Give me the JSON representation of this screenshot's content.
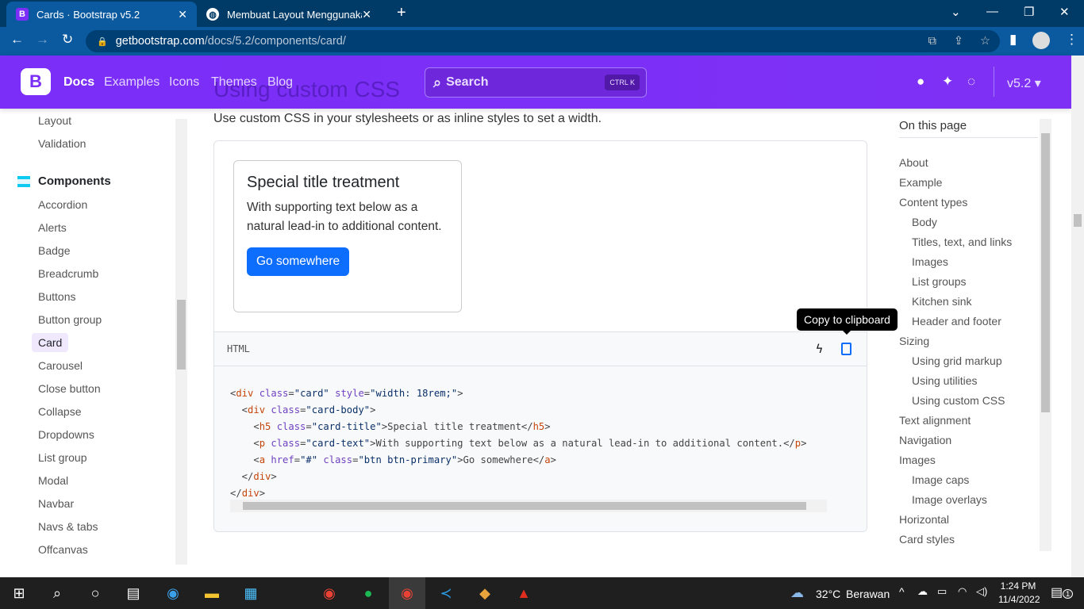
{
  "browser": {
    "tabs": [
      {
        "label": "Cards · Bootstrap v5.2",
        "favicon": "bootstrap-icon",
        "active": true
      },
      {
        "label": "Membuat Layout Menggunakan",
        "favicon": "globe-icon",
        "active": false
      }
    ],
    "url_host": "getbootstrap.com",
    "url_path": "/docs/5.2/components/card/"
  },
  "navbar": {
    "brand": "B",
    "links": [
      "Docs",
      "Examples",
      "Icons",
      "Themes",
      "Blog"
    ],
    "search_placeholder": "Search",
    "search_kbd": "CTRL K",
    "version": "v5.2",
    "accent": "#7a2ef7"
  },
  "sidebar": {
    "top_items": [
      "Layout",
      "Validation"
    ],
    "section": "Components",
    "items": [
      "Accordion",
      "Alerts",
      "Badge",
      "Breadcrumb",
      "Buttons",
      "Button group",
      "Card",
      "Carousel",
      "Close button",
      "Collapse",
      "Dropdowns",
      "List group",
      "Modal",
      "Navbar",
      "Navs & tabs",
      "Offcanvas"
    ],
    "active": "Card"
  },
  "main": {
    "heading": "Using custom CSS",
    "lead": "Use custom CSS in your stylesheets or as inline styles to set a width.",
    "card": {
      "title": "Special title treatment",
      "text": "With supporting text below as a natural lead-in to additional content.",
      "button": "Go somewhere",
      "button_color": "#0d6efd"
    },
    "code_lang": "HTML",
    "tooltip": "Copy to clipboard",
    "code_lines": [
      [
        [
          "<",
          "pn"
        ],
        [
          "div",
          "tg"
        ],
        [
          " class",
          "at"
        ],
        [
          "=",
          "pn"
        ],
        [
          "\"card\"",
          "st"
        ],
        [
          " style",
          "at"
        ],
        [
          "=",
          "pn"
        ],
        [
          "\"width: 18rem;\"",
          "st"
        ],
        [
          ">",
          "pn"
        ]
      ],
      [
        [
          "  <",
          "pn"
        ],
        [
          "div",
          "tg"
        ],
        [
          " class",
          "at"
        ],
        [
          "=",
          "pn"
        ],
        [
          "\"card-body\"",
          "st"
        ],
        [
          ">",
          "pn"
        ]
      ],
      [
        [
          "    <",
          "pn"
        ],
        [
          "h5",
          "tg"
        ],
        [
          " class",
          "at"
        ],
        [
          "=",
          "pn"
        ],
        [
          "\"card-title\"",
          "st"
        ],
        [
          ">Special title treatment</",
          "pn"
        ],
        [
          "h5",
          "tg"
        ],
        [
          ">",
          "pn"
        ]
      ],
      [
        [
          "    <",
          "pn"
        ],
        [
          "p",
          "tg"
        ],
        [
          " class",
          "at"
        ],
        [
          "=",
          "pn"
        ],
        [
          "\"card-text\"",
          "st"
        ],
        [
          ">With supporting text below as a natural lead-in to additional content.</",
          "pn"
        ],
        [
          "p",
          "tg"
        ],
        [
          ">",
          "pn"
        ]
      ],
      [
        [
          "    <",
          "pn"
        ],
        [
          "a",
          "tg"
        ],
        [
          " href",
          "at"
        ],
        [
          "=",
          "pn"
        ],
        [
          "\"#\"",
          "st"
        ],
        [
          " class",
          "at"
        ],
        [
          "=",
          "pn"
        ],
        [
          "\"btn btn-primary\"",
          "st"
        ],
        [
          ">Go somewhere</",
          "pn"
        ],
        [
          "a",
          "tg"
        ],
        [
          ">",
          "pn"
        ]
      ],
      [
        [
          "  </",
          "pn"
        ],
        [
          "div",
          "tg"
        ],
        [
          ">",
          "pn"
        ]
      ],
      [
        [
          "</",
          "pn"
        ],
        [
          "div",
          "tg"
        ],
        [
          ">",
          "pn"
        ]
      ]
    ]
  },
  "toc": {
    "title": "On this page",
    "items": [
      [
        "About",
        0
      ],
      [
        "Example",
        0
      ],
      [
        "Content types",
        0
      ],
      [
        "Body",
        1
      ],
      [
        "Titles, text, and links",
        1
      ],
      [
        "Images",
        1
      ],
      [
        "List groups",
        1
      ],
      [
        "Kitchen sink",
        1
      ],
      [
        "Header and footer",
        1
      ],
      [
        "Sizing",
        0
      ],
      [
        "Using grid markup",
        1
      ],
      [
        "Using utilities",
        1
      ],
      [
        "Using custom CSS",
        1
      ],
      [
        "Text alignment",
        0
      ],
      [
        "Navigation",
        0
      ],
      [
        "Images",
        0
      ],
      [
        "Image caps",
        1
      ],
      [
        "Image overlays",
        1
      ],
      [
        "Horizontal",
        0
      ],
      [
        "Card styles",
        0
      ]
    ]
  },
  "taskbar": {
    "weather_temp": "32°C",
    "weather_text": "Berawan",
    "time": "1:24 PM",
    "date": "11/4/2022",
    "notif_count": "1"
  }
}
